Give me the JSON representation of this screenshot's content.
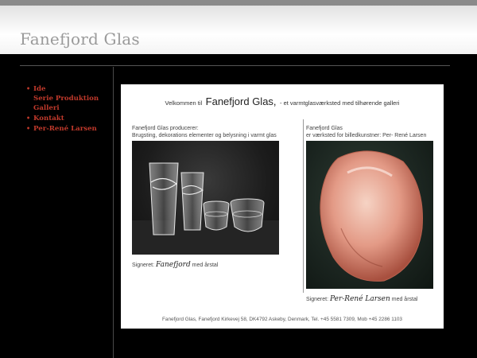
{
  "site": {
    "title": "Fanefjord Glas"
  },
  "nav": {
    "items": [
      {
        "label": "Ide",
        "bullet": true
      },
      {
        "label": "Serie Produktion",
        "bullet": false
      },
      {
        "label": "Galleri",
        "bullet": false
      },
      {
        "label": "Kontakt",
        "bullet": true
      },
      {
        "label": "Per-René Larsen",
        "bullet": true
      }
    ],
    "bullet_char": "•",
    "color": "#c0392b"
  },
  "content": {
    "welcome_prefix": "Velkommen til",
    "welcome_name": "Fanefjord Glas,",
    "welcome_suffix": "- et varmtglasværksted med tilhørende galleri",
    "left": {
      "line1": "Fanefjord Glas producerer:",
      "line2": "Brugsting, dekorations elementer og belysning i varmt glas",
      "sig_label": "Signeret:",
      "sig_script": "Fanefjord",
      "sig_suffix": "med årstal"
    },
    "right": {
      "line1": "Fanefjord Glas",
      "line2": "er værksted for billedkunstner: Per- René Larsen",
      "sig_label": "Signeret:",
      "sig_script": "Per-René Larsen",
      "sig_suffix": "med årstal"
    },
    "footer": "Fanefjord Glas, Fanefjord Kirkevej 58, DK4792 Askeby, Denmark, Tel. +45 5581 7309, Mob +45 2286 1103"
  }
}
